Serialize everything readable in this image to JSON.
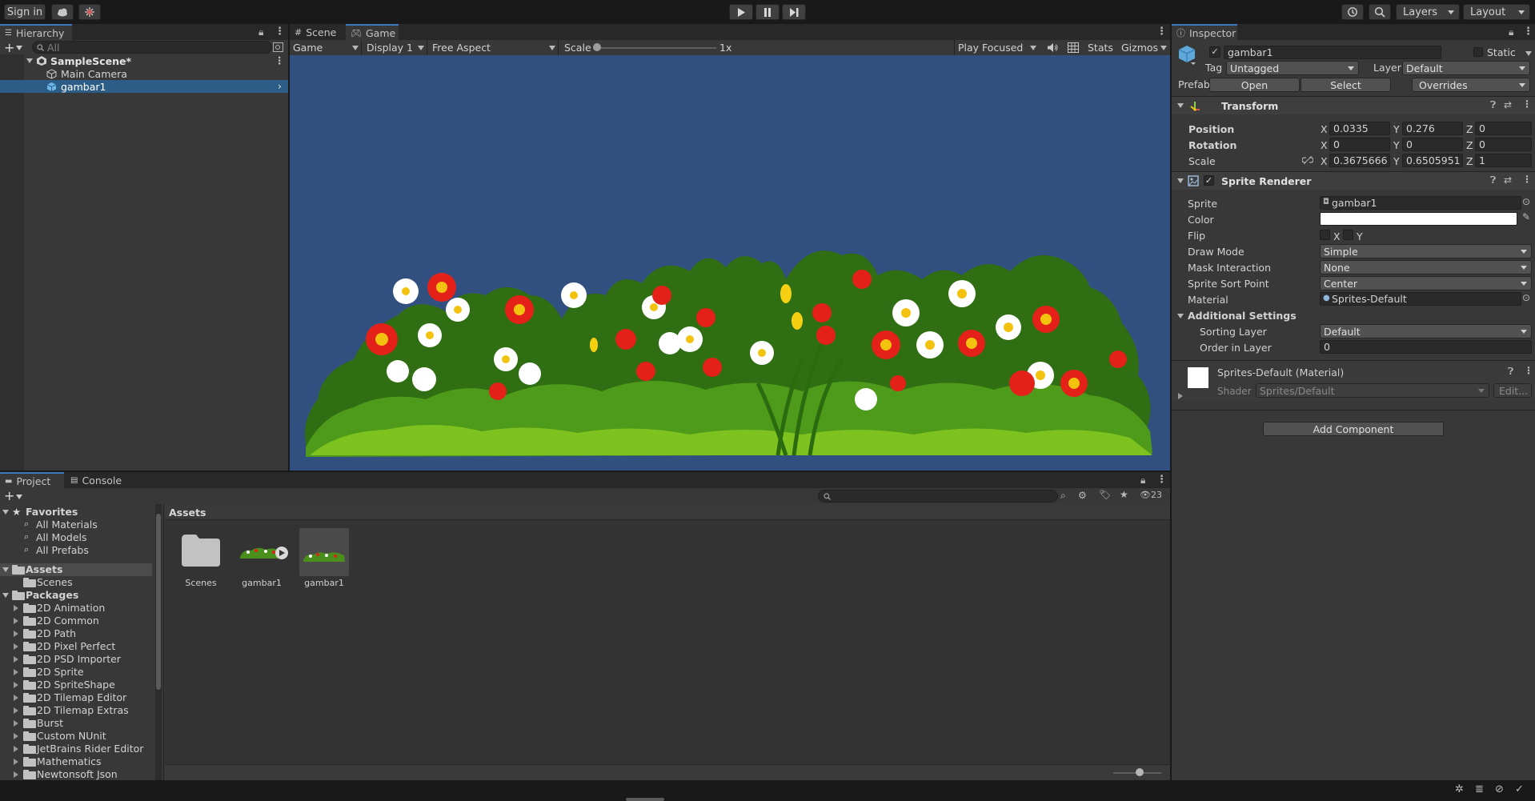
{
  "toolbar": {
    "sign_in": "Sign in",
    "layers": "Layers",
    "layout": "Layout"
  },
  "hierarchy": {
    "tab": "Hierarchy",
    "search_placeholder": "All",
    "scene": "SampleScene*",
    "items": [
      "Main Camera",
      "gambar1"
    ]
  },
  "game_view": {
    "tabs": [
      "Scene",
      "Game"
    ],
    "mode": "Game",
    "display": "Display 1",
    "aspect": "Free Aspect",
    "scale_label": "Scale",
    "scale_value": "1x",
    "play_focused": "Play Focused",
    "stats": "Stats",
    "gizmos": "Gizmos",
    "background_color": "#31507f"
  },
  "inspector": {
    "tab": "Inspector",
    "object_name": "gambar1",
    "static_label": "Static",
    "tag_label": "Tag",
    "tag_value": "Untagged",
    "layer_label": "Layer",
    "layer_value": "Default",
    "prefab_label": "Prefab",
    "prefab_open": "Open",
    "prefab_select": "Select",
    "prefab_overrides": "Overrides",
    "transform": {
      "title": "Transform",
      "position_label": "Position",
      "rotation_label": "Rotation",
      "scale_label": "Scale",
      "axes": [
        "X",
        "Y",
        "Z"
      ],
      "position": [
        "0.0335",
        "0.276",
        "0"
      ],
      "rotation": [
        "0",
        "0",
        "0"
      ],
      "scale": [
        "0.3675666",
        "0.6505951",
        "1"
      ]
    },
    "sprite_renderer": {
      "title": "Sprite Renderer",
      "sprite_label": "Sprite",
      "sprite_value": "gambar1",
      "color_label": "Color",
      "color_value": "#ffffff",
      "flip_label": "Flip",
      "flip_x": "X",
      "flip_y": "Y",
      "draw_mode_label": "Draw Mode",
      "draw_mode_value": "Simple",
      "mask_label": "Mask Interaction",
      "mask_value": "None",
      "sort_point_label": "Sprite Sort Point",
      "sort_point_value": "Center",
      "material_label": "Material",
      "material_value": "Sprites-Default",
      "additional_label": "Additional Settings",
      "sorting_layer_label": "Sorting Layer",
      "sorting_layer_value": "Default",
      "order_label": "Order in Layer",
      "order_value": "0"
    },
    "material": {
      "title": "Sprites-Default (Material)",
      "shader_label": "Shader",
      "shader_value": "Sprites/Default",
      "edit": "Edit..."
    },
    "add_component": "Add Component"
  },
  "project": {
    "tabs": [
      "Project",
      "Console"
    ],
    "hidden_count": "23",
    "favorites_label": "Favorites",
    "favorites": [
      "All Materials",
      "All Models",
      "All Prefabs"
    ],
    "assets_label": "Assets",
    "assets_children": [
      "Scenes"
    ],
    "packages_label": "Packages",
    "packages": [
      "2D Animation",
      "2D Common",
      "2D Path",
      "2D Pixel Perfect",
      "2D PSD Importer",
      "2D Sprite",
      "2D SpriteShape",
      "2D Tilemap Editor",
      "2D Tilemap Extras",
      "Burst",
      "Custom NUnit",
      "JetBrains Rider Editor",
      "Mathematics",
      "Newtonsoft Json"
    ],
    "breadcrumb": "Assets",
    "grid_items": [
      "Scenes",
      "gambar1",
      "gambar1"
    ]
  },
  "colors": {
    "accent": "#3a79bb",
    "selection": "#2c5d87",
    "panel": "#383838",
    "dark": "#191919"
  }
}
